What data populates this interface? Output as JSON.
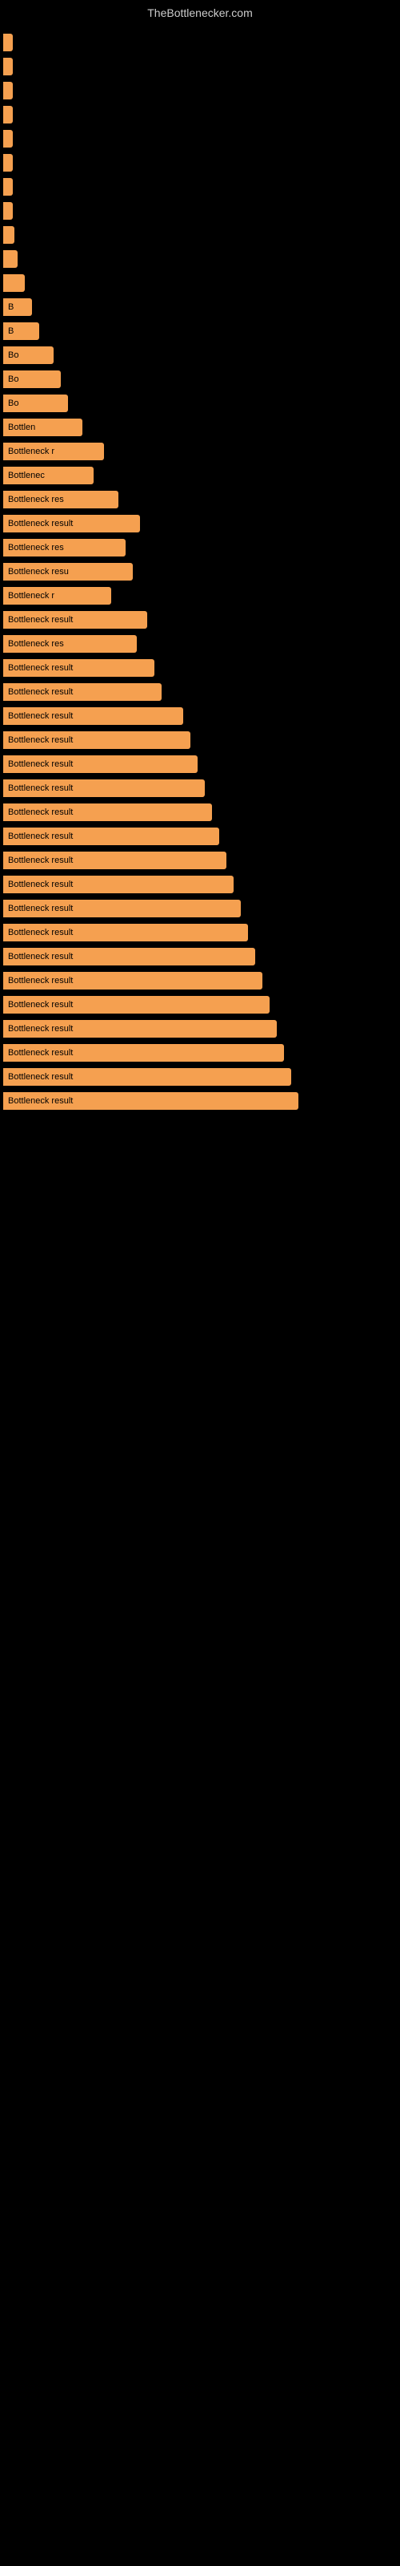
{
  "site": {
    "title": "TheBottlenecker.com"
  },
  "bars": [
    {
      "width": 2,
      "label": ""
    },
    {
      "width": 2,
      "label": ""
    },
    {
      "width": 2,
      "label": ""
    },
    {
      "width": 2,
      "label": ""
    },
    {
      "width": 2,
      "label": ""
    },
    {
      "width": 2,
      "label": ""
    },
    {
      "width": 2,
      "label": ""
    },
    {
      "width": 2,
      "label": ""
    },
    {
      "width": 3,
      "label": ""
    },
    {
      "width": 4,
      "label": ""
    },
    {
      "width": 6,
      "label": ""
    },
    {
      "width": 8,
      "label": "B"
    },
    {
      "width": 10,
      "label": "B"
    },
    {
      "width": 14,
      "label": "Bo"
    },
    {
      "width": 16,
      "label": "Bo"
    },
    {
      "width": 18,
      "label": "Bo"
    },
    {
      "width": 22,
      "label": "Bottlen"
    },
    {
      "width": 28,
      "label": "Bottleneck r"
    },
    {
      "width": 25,
      "label": "Bottlenec"
    },
    {
      "width": 32,
      "label": "Bottleneck res"
    },
    {
      "width": 38,
      "label": "Bottleneck result"
    },
    {
      "width": 34,
      "label": "Bottleneck res"
    },
    {
      "width": 36,
      "label": "Bottleneck resu"
    },
    {
      "width": 30,
      "label": "Bottleneck r"
    },
    {
      "width": 40,
      "label": "Bottleneck result"
    },
    {
      "width": 37,
      "label": "Bottleneck res"
    },
    {
      "width": 42,
      "label": "Bottleneck result"
    },
    {
      "width": 44,
      "label": "Bottleneck result"
    },
    {
      "width": 50,
      "label": "Bottleneck result"
    },
    {
      "width": 52,
      "label": "Bottleneck result"
    },
    {
      "width": 54,
      "label": "Bottleneck result"
    },
    {
      "width": 56,
      "label": "Bottleneck result"
    },
    {
      "width": 58,
      "label": "Bottleneck result"
    },
    {
      "width": 60,
      "label": "Bottleneck result"
    },
    {
      "width": 62,
      "label": "Bottleneck result"
    },
    {
      "width": 64,
      "label": "Bottleneck result"
    },
    {
      "width": 66,
      "label": "Bottleneck result"
    },
    {
      "width": 68,
      "label": "Bottleneck result"
    },
    {
      "width": 70,
      "label": "Bottleneck result"
    },
    {
      "width": 72,
      "label": "Bottleneck result"
    },
    {
      "width": 74,
      "label": "Bottleneck result"
    },
    {
      "width": 76,
      "label": "Bottleneck result"
    },
    {
      "width": 78,
      "label": "Bottleneck result"
    },
    {
      "width": 80,
      "label": "Bottleneck result"
    },
    {
      "width": 82,
      "label": "Bottleneck result"
    }
  ]
}
